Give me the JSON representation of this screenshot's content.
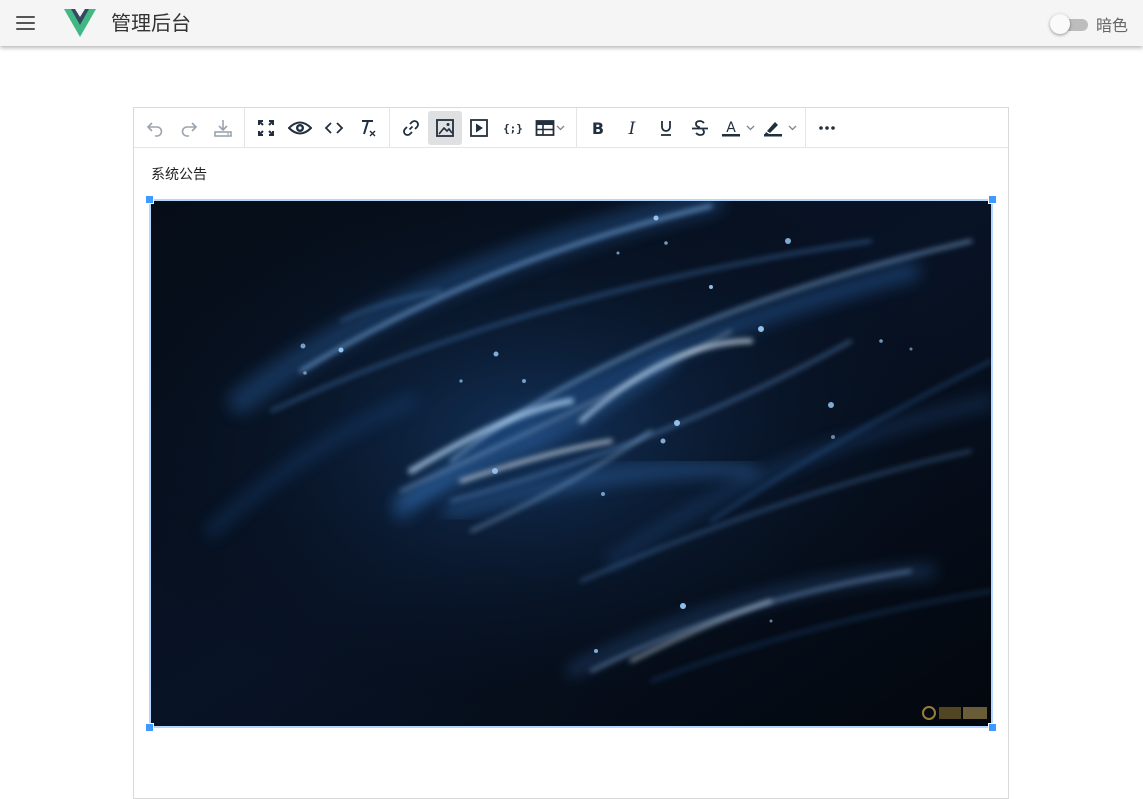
{
  "app": {
    "title": "管理后台",
    "theme_toggle_label": "暗色",
    "theme_dark_enabled": false
  },
  "toolbar": {
    "groups": [
      [
        "undo-icon",
        "redo-icon",
        "save-icon"
      ],
      [
        "fullscreen-icon",
        "preview-icon",
        "code-icon",
        "clear-format-icon"
      ],
      [
        "link-icon",
        "image-icon",
        "media-icon",
        "template-icon",
        "table-icon"
      ],
      [
        "bold-icon",
        "italic-icon",
        "underline-icon",
        "strikethrough-icon",
        "text-color-icon",
        "highlight-color-icon"
      ],
      [
        "more-icon"
      ]
    ],
    "active_button": "image-icon"
  },
  "editor": {
    "paragraph": "系统公告",
    "image_selected": true
  },
  "colors": {
    "appbar_bg": "#f5f5f5",
    "selection": "#b4d7ff",
    "handle": "#4099ff",
    "logo_outer": "#41b883",
    "logo_inner": "#35495e"
  }
}
